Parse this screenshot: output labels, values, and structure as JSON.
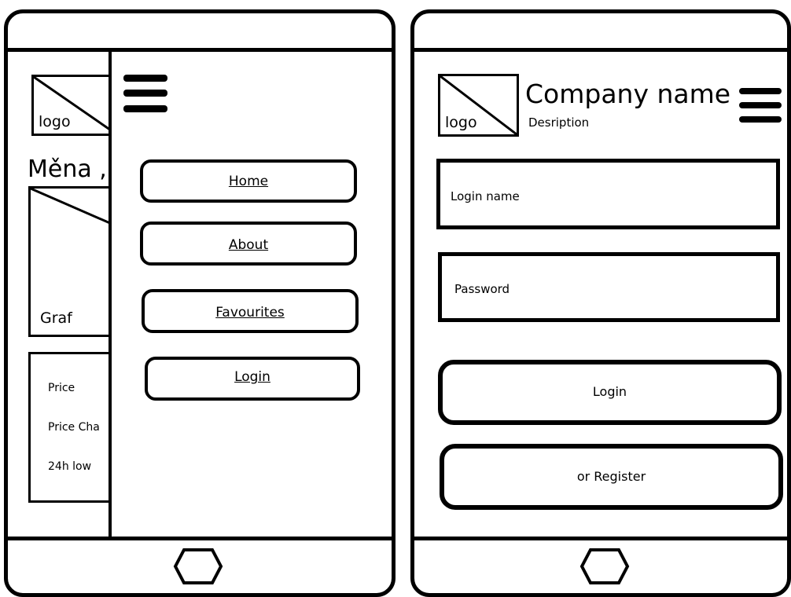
{
  "left_device": {
    "logo_label": "logo",
    "heading": "Měna ,",
    "chart_label": "Graf",
    "stats": [
      "Price",
      "Price Cha",
      "24h low"
    ],
    "menu_icon": "hamburger-icon",
    "menu_items": [
      "Home",
      "About",
      "Favourites",
      "Login"
    ],
    "home_icon": "hexagon-home-icon"
  },
  "right_device": {
    "logo_label": "logo",
    "company_name": "Company name",
    "description": "Desription",
    "menu_icon": "hamburger-icon",
    "login_name_placeholder": "Login name",
    "password_placeholder": "Password",
    "login_button": "Login",
    "register_button": "or Register",
    "home_icon": "hexagon-home-icon"
  }
}
